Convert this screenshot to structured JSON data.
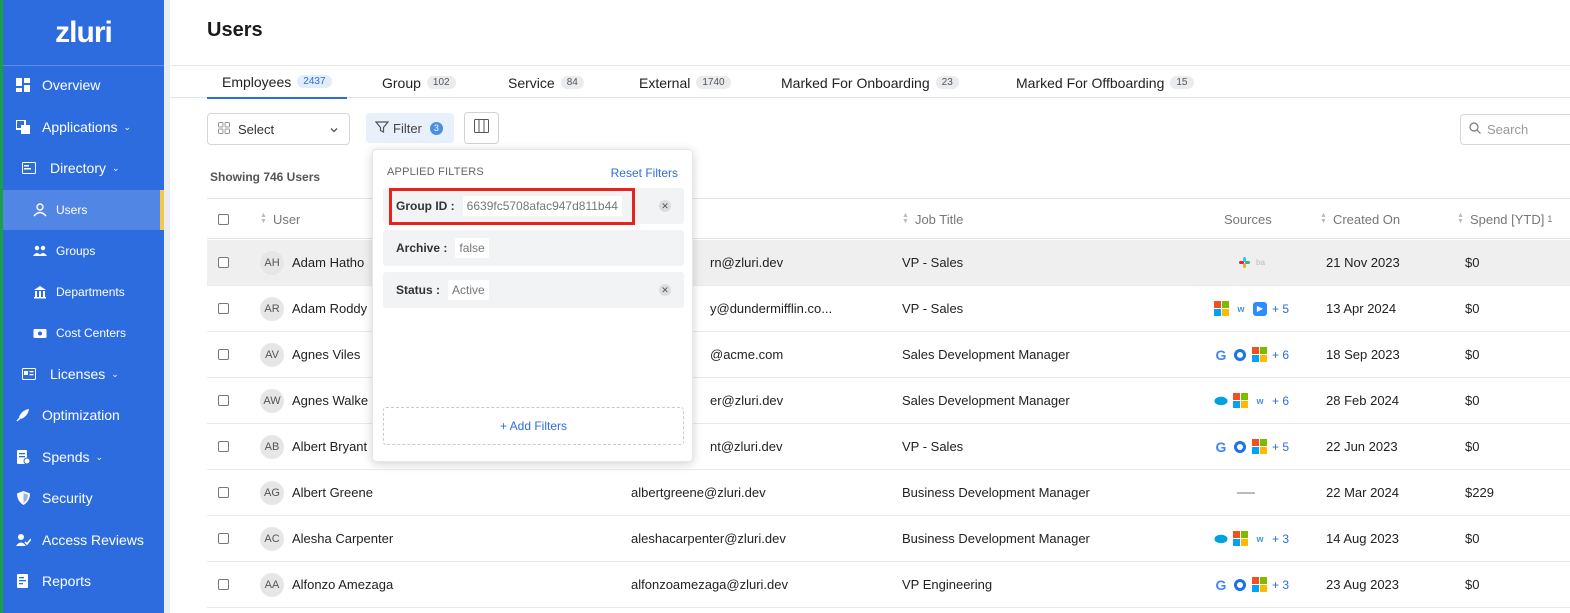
{
  "app": {
    "logo": "zluri"
  },
  "sidebar": {
    "items": [
      {
        "label": "Overview",
        "icon": "dashboard-icon"
      },
      {
        "label": "Applications",
        "icon": "applications-icon",
        "caret": "⌄"
      },
      {
        "label": "Directory",
        "icon": "directory-icon",
        "caret": "⌄"
      },
      {
        "label": "Users",
        "icon": "users-icon"
      },
      {
        "label": "Groups",
        "icon": "groups-icon"
      },
      {
        "label": "Departments",
        "icon": "building-icon"
      },
      {
        "label": "Cost Centers",
        "icon": "cost-center-icon"
      },
      {
        "label": "Licenses",
        "icon": "licenses-icon",
        "caret": "⌄"
      },
      {
        "label": "Optimization",
        "icon": "rocket-icon"
      },
      {
        "label": "Spends",
        "icon": "spends-icon",
        "caret": "⌄"
      },
      {
        "label": "Security",
        "icon": "shield-icon"
      },
      {
        "label": "Access Reviews",
        "icon": "access-review-icon"
      },
      {
        "label": "Reports",
        "icon": "reports-icon"
      }
    ]
  },
  "page": {
    "title": "Users"
  },
  "tabs": [
    {
      "label": "Employees",
      "count": "2437"
    },
    {
      "label": "Group",
      "count": "102"
    },
    {
      "label": "Service",
      "count": "84"
    },
    {
      "label": "External",
      "count": "1740"
    },
    {
      "label": "Marked For Onboarding",
      "count": "23"
    },
    {
      "label": "Marked For Offboarding",
      "count": "15"
    }
  ],
  "toolbar": {
    "select_label": "Select",
    "filter_label": "Filter",
    "filter_count": "3",
    "search_placeholder": "Search"
  },
  "showing_text": "Showing 746 Users",
  "table": {
    "headers": {
      "user": "User",
      "job_title": "Job Title",
      "sources": "Sources",
      "created_on": "Created On",
      "spend": "Spend [YTD]",
      "spend_sup": "1"
    },
    "rows": [
      {
        "initials": "AH",
        "name": "Adam Hatho",
        "email": "rn@zluri.dev",
        "job": "VP - Sales",
        "created": "21 Nov 2023",
        "spend": "$0",
        "more": ""
      },
      {
        "initials": "AR",
        "name": "Adam Roddy",
        "email": "y@dundermifflin.co...",
        "job": "VP - Sales",
        "created": "13 Apr 2024",
        "spend": "$0",
        "more": "+ 5"
      },
      {
        "initials": "AV",
        "name": "Agnes Viles",
        "email": "@acme.com",
        "job": "Sales Development Manager",
        "created": "18 Sep 2023",
        "spend": "$0",
        "more": "+ 6"
      },
      {
        "initials": "AW",
        "name": "Agnes Walke",
        "email": "er@zluri.dev",
        "job": "Sales Development Manager",
        "created": "28 Feb 2024",
        "spend": "$0",
        "more": "+ 6"
      },
      {
        "initials": "AB",
        "name": "Albert Bryant",
        "email": "nt@zluri.dev",
        "job": "VP - Sales",
        "created": "22 Jun 2023",
        "spend": "$0",
        "more": "+ 5"
      },
      {
        "initials": "AG",
        "name": "Albert Greene",
        "email": "albertgreene@zluri.dev",
        "job": "Business Development Manager",
        "created": "22 Mar 2024",
        "spend": "$229",
        "more": ""
      },
      {
        "initials": "AC",
        "name": "Alesha Carpenter",
        "email": "aleshacarpenter@zluri.dev",
        "job": "Business Development Manager",
        "created": "14 Aug 2023",
        "spend": "$0",
        "more": "+ 3"
      },
      {
        "initials": "AA",
        "name": "Alfonzo Amezaga",
        "email": "alfonzoamezaga@zluri.dev",
        "job": "VP Engineering",
        "created": "23 Aug 2023",
        "spend": "$0",
        "more": "+ 3"
      }
    ]
  },
  "filters_panel": {
    "heading": "APPLIED FILTERS",
    "reset_label": "Reset Filters",
    "filters": [
      {
        "key": "Group ID :",
        "value": "6639fc5708afac947d811b44"
      },
      {
        "key": "Archive :",
        "value": "false"
      },
      {
        "key": "Status :",
        "value": "Active"
      }
    ],
    "add_label": "+ Add Filters"
  },
  "colors": {
    "sidebar": "#2d6cdf",
    "accent": "#2d6cdf",
    "highlight": "#e8231c"
  }
}
